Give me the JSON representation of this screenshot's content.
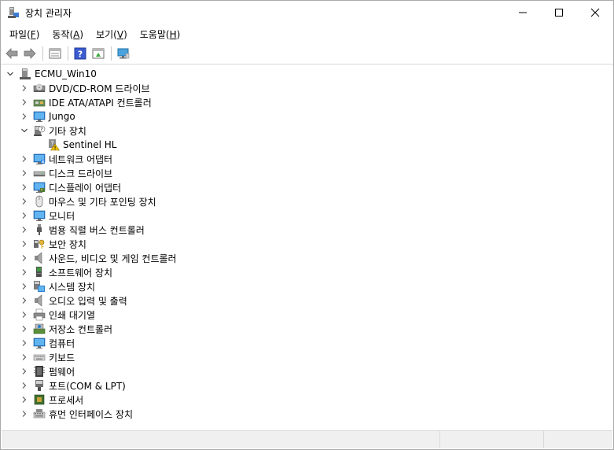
{
  "window": {
    "title": "장치 관리자",
    "icon": "device-manager-icon"
  },
  "menu": [
    {
      "label": "파일",
      "key": "F"
    },
    {
      "label": "동작",
      "key": "A"
    },
    {
      "label": "보기",
      "key": "V"
    },
    {
      "label": "도움말",
      "key": "H"
    }
  ],
  "toolbar": {
    "buttons": [
      "back-arrow-icon",
      "forward-arrow-icon",
      "properties-icon",
      "help-icon",
      "update-driver-icon",
      "scan-hardware-icon"
    ]
  },
  "tree": {
    "root": {
      "label": "ECMU_Win10",
      "expanded": true,
      "icon": "computer-tower-icon"
    },
    "items": [
      {
        "label": "DVD/CD-ROM 드라이브",
        "expanded": false,
        "icon": "dvd-drive-icon"
      },
      {
        "label": "IDE ATA/ATAPI 컨트롤러",
        "expanded": false,
        "icon": "ide-controller-icon"
      },
      {
        "label": "Jungo",
        "expanded": false,
        "icon": "jungo-icon"
      },
      {
        "label": "기타 장치",
        "expanded": true,
        "icon": "other-devices-icon",
        "children": [
          {
            "label": "Sentinel HL",
            "icon": "unknown-device-warning-icon"
          }
        ]
      },
      {
        "label": "네트워크 어댑터",
        "expanded": false,
        "icon": "network-adapter-icon"
      },
      {
        "label": "디스크 드라이브",
        "expanded": false,
        "icon": "disk-drive-icon"
      },
      {
        "label": "디스플레이 어댑터",
        "expanded": false,
        "icon": "display-adapter-icon"
      },
      {
        "label": "마우스 및 기타 포인팅 장치",
        "expanded": false,
        "icon": "mouse-icon"
      },
      {
        "label": "모니터",
        "expanded": false,
        "icon": "monitor-icon"
      },
      {
        "label": "범용 직렬 버스 컨트롤러",
        "expanded": false,
        "icon": "usb-icon"
      },
      {
        "label": "보안 장치",
        "expanded": false,
        "icon": "security-device-icon"
      },
      {
        "label": "사운드, 비디오 및 게임 컨트롤러",
        "expanded": false,
        "icon": "speaker-icon"
      },
      {
        "label": "소프트웨어 장치",
        "expanded": false,
        "icon": "software-device-icon"
      },
      {
        "label": "시스템 장치",
        "expanded": false,
        "icon": "system-device-icon"
      },
      {
        "label": "오디오 입력 및 출력",
        "expanded": false,
        "icon": "audio-io-icon"
      },
      {
        "label": "인쇄 대기열",
        "expanded": false,
        "icon": "printer-icon"
      },
      {
        "label": "저장소 컨트롤러",
        "expanded": false,
        "icon": "storage-controller-icon"
      },
      {
        "label": "컴퓨터",
        "expanded": false,
        "icon": "computer-icon"
      },
      {
        "label": "키보드",
        "expanded": false,
        "icon": "keyboard-icon"
      },
      {
        "label": "펌웨어",
        "expanded": false,
        "icon": "firmware-icon"
      },
      {
        "label": "포트(COM & LPT)",
        "expanded": false,
        "icon": "port-icon"
      },
      {
        "label": "프로세서",
        "expanded": false,
        "icon": "processor-icon"
      },
      {
        "label": "휴먼 인터페이스 장치",
        "expanded": false,
        "icon": "hid-icon"
      }
    ]
  },
  "colors": {
    "accent": "#2b6cb0",
    "warning": "#f2c200"
  }
}
